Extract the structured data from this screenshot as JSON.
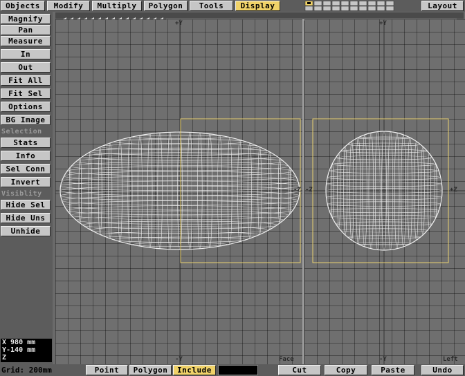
{
  "tabs": [
    {
      "label": "Objects",
      "active": false
    },
    {
      "label": "Modify",
      "active": false
    },
    {
      "label": "Multiply",
      "active": false
    },
    {
      "label": "Polygon",
      "active": false
    },
    {
      "label": "Tools",
      "active": false
    },
    {
      "label": "Display",
      "active": true
    }
  ],
  "layout_button": "Layout",
  "left_panel": {
    "buttons_top": [
      "Magnify",
      "Pan",
      "Measure",
      "In",
      "Out",
      "Fit All",
      "Fit Sel",
      "Options",
      "BG Image"
    ],
    "selection_label": "Selection",
    "buttons_selection": [
      "Stats",
      "Info",
      "Sel Conn",
      "Invert"
    ],
    "visibility_label": "Visiblity",
    "buttons_visibility": [
      "Hide Sel",
      "Hide Uns",
      "Unhide"
    ]
  },
  "coord_readout": {
    "x": "X 980  mm",
    "y": "Y-140  mm",
    "z": "Z"
  },
  "bottom": {
    "grid_label": "Grid: 200mm",
    "mode_buttons": [
      {
        "label": "Point",
        "active": false
      },
      {
        "label": "Polygon",
        "active": false
      },
      {
        "label": "Include",
        "active": true
      }
    ],
    "edit_buttons": [
      "Cut",
      "Copy",
      "Paste",
      "Undo"
    ]
  },
  "viewports": {
    "left": {
      "axis_top": "+Y",
      "axis_bottom": "-Y",
      "axis_right": "-Z",
      "view_name": "Face"
    },
    "right": {
      "axis_top": "+Y",
      "axis_bottom": "-Y",
      "axis_left": "-Z",
      "axis_right": "+Z",
      "view_name": "Left"
    }
  },
  "colors": {
    "accent": "#f0d268",
    "grid": "#6f6f6f",
    "wire": "#ffffff",
    "bounding_box": "#e8d070"
  }
}
